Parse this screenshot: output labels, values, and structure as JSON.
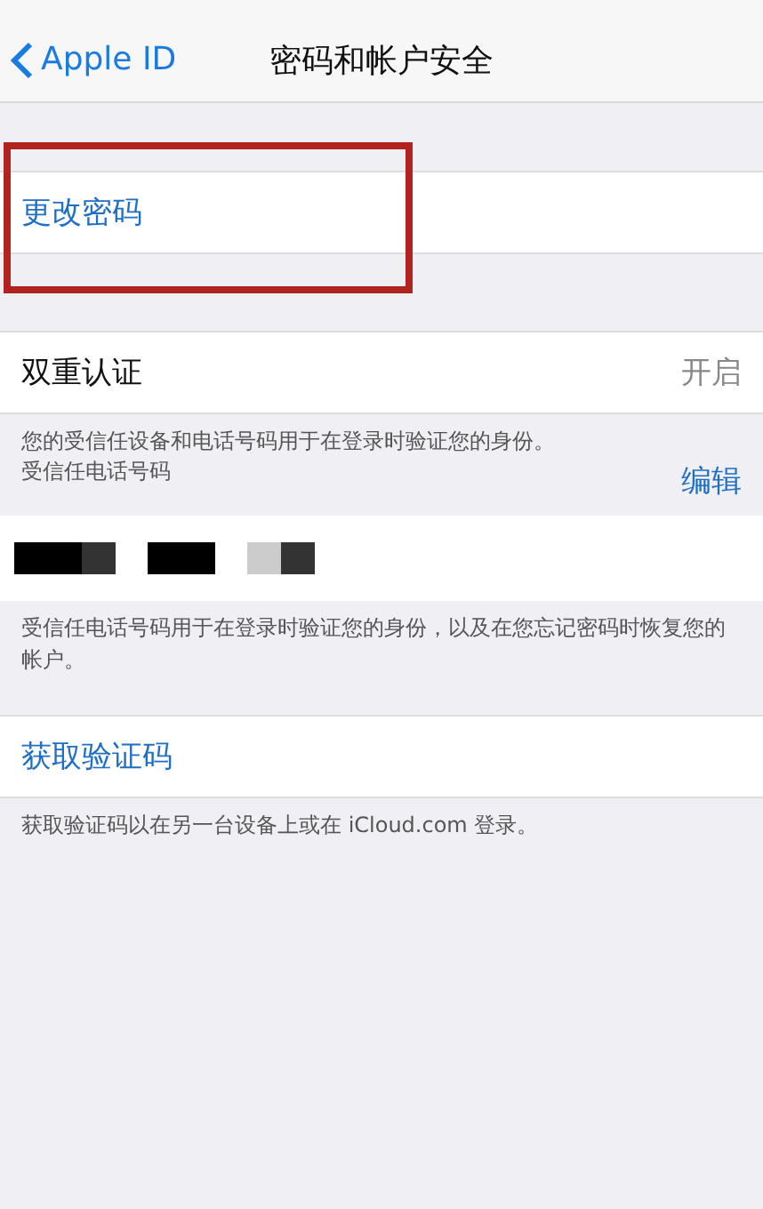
{
  "nav": {
    "back": "Apple ID",
    "title": "密码和帐户安全"
  },
  "change_password": {
    "label": "更改密码",
    "highlighted": true
  },
  "two_factor": {
    "label": "双重认证",
    "value": "开启"
  },
  "two_factor_note": "您的受信任设备和电话号码用于在登录时验证您的身份。",
  "trusted_header": {
    "label": "受信任电话号码",
    "action": "编辑"
  },
  "trusted_note": "受信任电话号码用于在登录时验证您的身份，以及在您忘记密码时恢复您的帐户。",
  "get_code": {
    "label": "获取验证码"
  },
  "get_code_note": "获取验证码以在另一台设备上或在 iCloud.com 登录。"
}
